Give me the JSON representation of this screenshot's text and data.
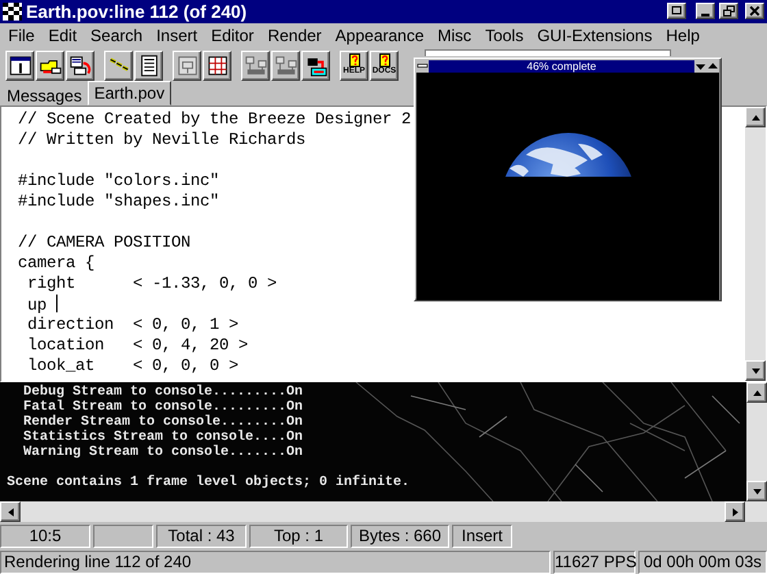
{
  "window": {
    "title": "Earth.pov:line 112 (of 240)"
  },
  "menu": [
    "File",
    "Edit",
    "Search",
    "Insert",
    "Editor",
    "Render",
    "Appearance",
    "Misc",
    "Tools",
    "GUI-Extensions",
    "Help"
  ],
  "toolbar": {
    "buttons": [
      {
        "kind": "window",
        "disabled": false
      },
      {
        "kind": "folder",
        "disabled": false
      },
      {
        "kind": "queue",
        "disabled": false
      },
      {
        "kind": "arrows",
        "disabled": false
      },
      {
        "kind": "list",
        "disabled": false
      },
      {
        "kind": "film",
        "disabled": true
      },
      {
        "kind": "grid",
        "disabled": false
      },
      {
        "kind": "network",
        "disabled": true
      },
      {
        "kind": "network",
        "disabled": true
      },
      {
        "kind": "camera",
        "disabled": false
      },
      {
        "kind": "help",
        "label": "HELP",
        "disabled": false
      },
      {
        "kind": "help",
        "label": "DOCS",
        "disabled": false
      }
    ]
  },
  "tabs": [
    {
      "label": "Messages",
      "selected": false
    },
    {
      "label": "Earth.pov",
      "selected": true
    }
  ],
  "editor": {
    "blocks": [
      [
        {
          "text": "// Scene Created by the Breeze Designer 2",
          "cursor": false
        },
        {
          "text": "// Written by Neville Richards",
          "cursor": false
        }
      ],
      [
        {
          "text": "#include \"colors.inc\"",
          "cursor": false
        },
        {
          "text": "#include \"shapes.inc\"",
          "cursor": false
        }
      ],
      [
        {
          "text": "// CAMERA POSITION",
          "cursor": false
        },
        {
          "text": "camera {",
          "cursor": false
        },
        {
          "text": " right      < -1.33, 0, 0 >",
          "cursor": false
        },
        {
          "text": " up ",
          "cursor": true
        },
        {
          "text": " direction  < 0, 0, 1 >",
          "cursor": false
        },
        {
          "text": " location   < 0, 4, 20 >",
          "cursor": false
        },
        {
          "text": " look_at    < 0, 0, 0 >",
          "cursor": false
        }
      ]
    ]
  },
  "render_window": {
    "title": "46% complete"
  },
  "console": {
    "lines": [
      "  Debug Stream to console.........On",
      "  Fatal Stream to console.........On",
      "  Render Stream to console........On",
      "  Statistics Stream to console....On",
      "  Warning Stream to console.......On"
    ],
    "summary": "Scene contains 1 frame level objects; 0 infinite."
  },
  "status_bar": {
    "cells": [
      {
        "kind": "text",
        "text": "10:5"
      },
      {
        "kind": "blank"
      },
      {
        "kind": "text",
        "text": "Total : 43"
      },
      {
        "kind": "text",
        "text": "Top : 1"
      },
      {
        "kind": "text",
        "text": "Bytes : 660"
      },
      {
        "kind": "text",
        "text": "Insert"
      }
    ]
  },
  "render_status": {
    "message": "Rendering line  112 of 240",
    "rate": "11627 PPS",
    "elapsed": "0d 00h 00m 03s"
  }
}
